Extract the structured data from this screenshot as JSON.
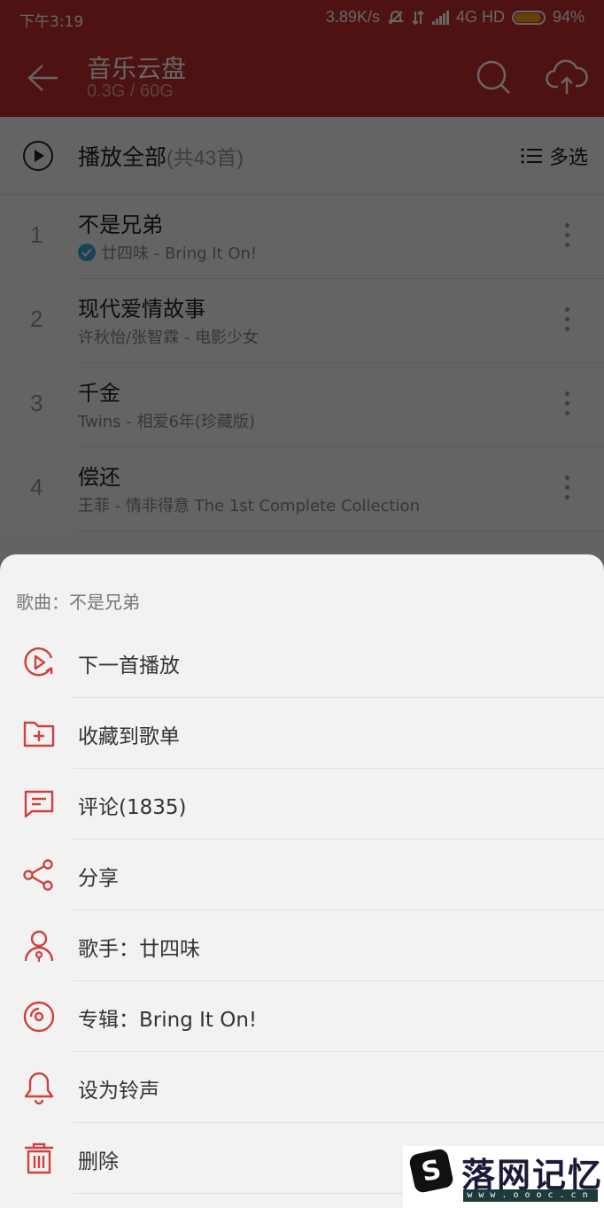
{
  "status_bar": {
    "time": "下午3:19",
    "net_speed": "3.89K/s",
    "icons": [
      "alarm-off-icon",
      "data-transfer-icon",
      "signal-icon"
    ],
    "network": "4G HD",
    "battery_percent": "94%",
    "battery_level": 0.94
  },
  "header": {
    "title": "音乐云盘",
    "subtitle": "0.3G / 60G",
    "back_icon": "arrow-left-icon",
    "search_icon": "search-icon",
    "upload_icon": "cloud-upload-icon",
    "color": "#c62f2f"
  },
  "play_all": {
    "label": "播放全部",
    "count": "(共43首)",
    "multi_select": "多选"
  },
  "songs": [
    {
      "index": "1",
      "name": "不是兄弟",
      "meta": "廿四味 - Bring It On!",
      "cloud_uploaded": true
    },
    {
      "index": "2",
      "name": "现代爱情故事",
      "meta": "许秋怡/张智霖 - 电影少女",
      "cloud_uploaded": false
    },
    {
      "index": "3",
      "name": "千金",
      "meta": "Twins - 相爱6年(珍藏版)",
      "cloud_uploaded": false
    },
    {
      "index": "4",
      "name": "偿还",
      "meta": "王菲 - 情非得意 The 1st Complete Collection",
      "cloud_uploaded": false
    }
  ],
  "sheet": {
    "heading": "歌曲：不是兄弟",
    "accent_color": "#d0403c",
    "items": [
      {
        "icon": "play-next-icon",
        "label": "下一首播放"
      },
      {
        "icon": "add-to-playlist-icon",
        "label": "收藏到歌单"
      },
      {
        "icon": "comment-icon",
        "label": "评论(1835)"
      },
      {
        "icon": "share-icon",
        "label": "分享"
      },
      {
        "icon": "artist-icon",
        "label": "歌手：廿四味"
      },
      {
        "icon": "album-icon",
        "label": "专辑：Bring It On!"
      },
      {
        "icon": "bell-icon",
        "label": "设为铃声"
      },
      {
        "icon": "trash-icon",
        "label": "删除"
      }
    ]
  },
  "watermark": {
    "brand": "落网记忆",
    "url": "www.oooc.cn"
  }
}
